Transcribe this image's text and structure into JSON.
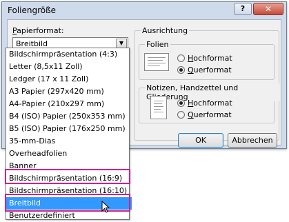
{
  "window": {
    "title": "Foliengröße",
    "help_label": "?",
    "close_label": "✕"
  },
  "paper_format": {
    "label": "Papierformat:",
    "label_access_key": "P",
    "label_rest": "apierformat:",
    "selected_value": "Breitbild",
    "arrow_icon": "chevron-down-icon"
  },
  "ausrichtung": {
    "label": "Ausrichtung",
    "folien": {
      "label": "Folien",
      "hochformat": "Hochformat",
      "querformat": "Querformat",
      "selected": "Querformat"
    },
    "notizen": {
      "label": "Notizen, Handzettel und Gliederung",
      "hochformat": "Hochformat",
      "querformat": "Querformat",
      "selected": "Hochformat"
    }
  },
  "buttons": {
    "ok": "OK",
    "cancel": "Abbrechen"
  },
  "dropdown": {
    "options": [
      "Bildschirmpräsentation (4:3)",
      "Letter (8,5x11 Zoll)",
      "Ledger (17 x 11 Zoll)",
      "A3 Papier (297x420 mm)",
      "A4-Papier (210x297 mm)",
      "B4 (ISO) Papier (250x353 mm)",
      "B5 (ISO) Papier (176x250 mm)",
      "35-mm-Dias",
      "Overheadfolien",
      "Banner",
      "Bildschirmpräsentation (16:9)",
      "Bildschirmpräsentation (16:10)",
      "Breitbild",
      "Benutzerdefiniert"
    ],
    "selected": "Breitbild",
    "highlighted": [
      "Bildschirmpräsentation (16:9)",
      "Breitbild"
    ]
  },
  "colors": {
    "highlight_border": "#d21f8b",
    "selection": "#3399ff",
    "dialog_frame": "#cfdbea"
  }
}
